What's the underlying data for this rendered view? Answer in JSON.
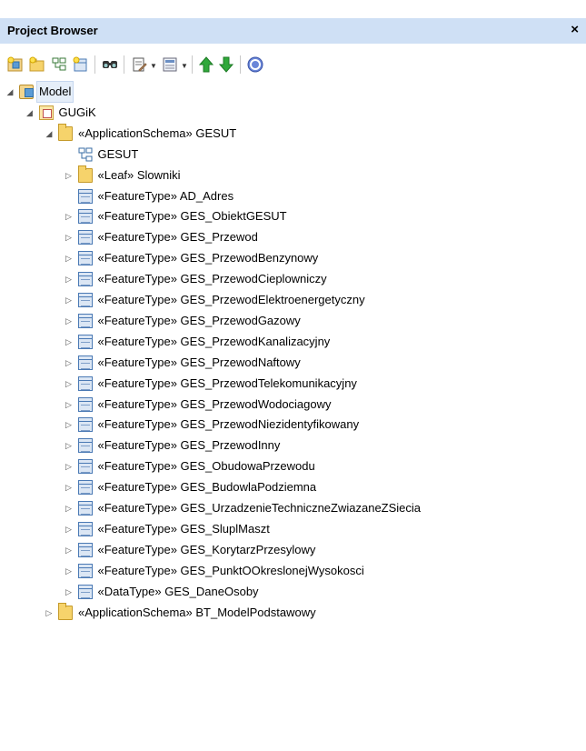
{
  "window": {
    "title": "Project Browser",
    "close_glyph": "×"
  },
  "toolbar": {
    "buttons": [
      {
        "icon": "new-model-icon"
      },
      {
        "icon": "new-package-icon"
      },
      {
        "icon": "new-diagram-icon"
      },
      {
        "icon": "new-element-icon"
      },
      {
        "icon": "find-icon"
      },
      {
        "icon": "properties-icon"
      },
      {
        "icon": "view-options-icon"
      },
      {
        "icon": "move-up-icon"
      },
      {
        "icon": "move-down-icon"
      },
      {
        "icon": "help-icon"
      }
    ]
  },
  "tree": {
    "nodes": [
      {
        "label": "Model",
        "icon": "model-icon",
        "level": 0,
        "expander": "expanded",
        "selected": true
      },
      {
        "label": "GUGiK",
        "icon": "package-icon",
        "level": 1,
        "expander": "expanded"
      },
      {
        "label": "«ApplicationSchema» GESUT",
        "icon": "folder-icon",
        "level": 2,
        "expander": "expanded"
      },
      {
        "label": "GESUT",
        "icon": "diagram-icon",
        "level": 3,
        "expander": "none"
      },
      {
        "label": "«Leaf» Slowniki",
        "icon": "folder-icon",
        "level": 3,
        "expander": "collapsed"
      },
      {
        "label": "«FeatureType» AD_Adres",
        "icon": "class-icon",
        "level": 3,
        "expander": "none"
      },
      {
        "label": "«FeatureType» GES_ObiektGESUT",
        "icon": "class-icon",
        "level": 3,
        "expander": "collapsed"
      },
      {
        "label": "«FeatureType» GES_Przewod",
        "icon": "class-icon",
        "level": 3,
        "expander": "collapsed"
      },
      {
        "label": "«FeatureType» GES_PrzewodBenzynowy",
        "icon": "class-icon",
        "level": 3,
        "expander": "collapsed"
      },
      {
        "label": "«FeatureType» GES_PrzewodCieplowniczy",
        "icon": "class-icon",
        "level": 3,
        "expander": "collapsed"
      },
      {
        "label": "«FeatureType» GES_PrzewodElektroenergetyczny",
        "icon": "class-icon",
        "level": 3,
        "expander": "collapsed"
      },
      {
        "label": "«FeatureType» GES_PrzewodGazowy",
        "icon": "class-icon",
        "level": 3,
        "expander": "collapsed"
      },
      {
        "label": "«FeatureType» GES_PrzewodKanalizacyjny",
        "icon": "class-icon",
        "level": 3,
        "expander": "collapsed"
      },
      {
        "label": "«FeatureType» GES_PrzewodNaftowy",
        "icon": "class-icon",
        "level": 3,
        "expander": "collapsed"
      },
      {
        "label": "«FeatureType» GES_PrzewodTelekomunikacyjny",
        "icon": "class-icon",
        "level": 3,
        "expander": "collapsed"
      },
      {
        "label": "«FeatureType» GES_PrzewodWodociagowy",
        "icon": "class-icon",
        "level": 3,
        "expander": "collapsed"
      },
      {
        "label": "«FeatureType» GES_PrzewodNiezidentyfikowany",
        "icon": "class-icon",
        "level": 3,
        "expander": "collapsed"
      },
      {
        "label": "«FeatureType» GES_PrzewodInny",
        "icon": "class-icon",
        "level": 3,
        "expander": "collapsed"
      },
      {
        "label": "«FeatureType» GES_ObudowaPrzewodu",
        "icon": "class-icon",
        "level": 3,
        "expander": "collapsed"
      },
      {
        "label": "«FeatureType» GES_BudowlaPodziemna",
        "icon": "class-icon",
        "level": 3,
        "expander": "collapsed"
      },
      {
        "label": "«FeatureType» GES_UrzadzenieTechniczneZwiazaneZSiecia",
        "icon": "class-icon",
        "level": 3,
        "expander": "collapsed"
      },
      {
        "label": "«FeatureType» GES_SluplMaszt",
        "icon": "class-icon",
        "level": 3,
        "expander": "collapsed"
      },
      {
        "label": "«FeatureType» GES_KorytarzPrzesylowy",
        "icon": "class-icon",
        "level": 3,
        "expander": "collapsed"
      },
      {
        "label": "«FeatureType» GES_PunktOOkreslonejWysokosci",
        "icon": "class-icon",
        "level": 3,
        "expander": "collapsed"
      },
      {
        "label": "«DataType» GES_DaneOsoby",
        "icon": "class-icon",
        "level": 3,
        "expander": "collapsed"
      },
      {
        "label": "«ApplicationSchema» BT_ModelPodstawowy",
        "icon": "folder-icon",
        "level": 2,
        "expander": "collapsed"
      }
    ]
  },
  "colors": {
    "title_bar": "#cfe0f5",
    "selection": "#e5eef9"
  }
}
